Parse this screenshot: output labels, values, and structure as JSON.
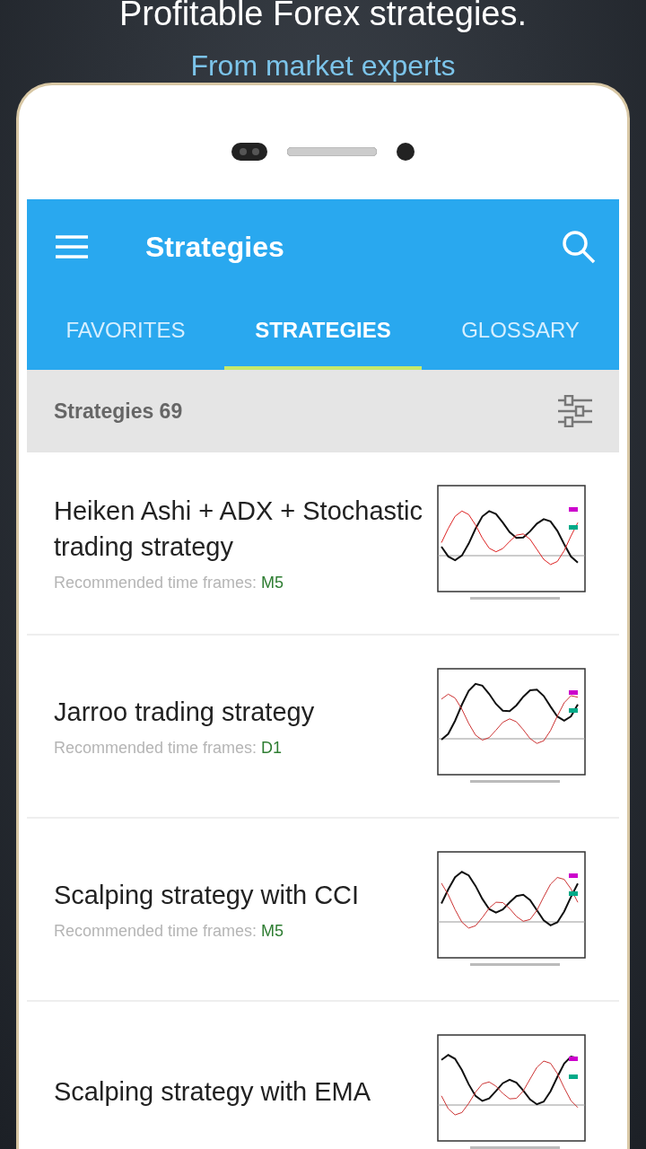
{
  "promo": {
    "headline": "Profitable Forex strategies.",
    "subline": "From market experts"
  },
  "app_bar": {
    "title": "Strategies"
  },
  "tabs": [
    {
      "label": "FAVORITES",
      "selected": false
    },
    {
      "label": "STRATEGIES",
      "selected": true
    },
    {
      "label": "GLOSSARY",
      "selected": false
    }
  ],
  "list_header": {
    "label": "Strategies 69"
  },
  "strategies": [
    {
      "title": "Heiken Ashi + ADX + Stochastic trading strategy",
      "time_frames_label": "Recommended time frames:",
      "time_frames": "M5"
    },
    {
      "title": "Jarroo trading strategy",
      "time_frames_label": "Recommended time frames:",
      "time_frames": "D1"
    },
    {
      "title": "Scalping strategy with CCI",
      "time_frames_label": "Recommended time frames:",
      "time_frames": "M5"
    },
    {
      "title": "Scalping strategy with EMA"
    }
  ]
}
